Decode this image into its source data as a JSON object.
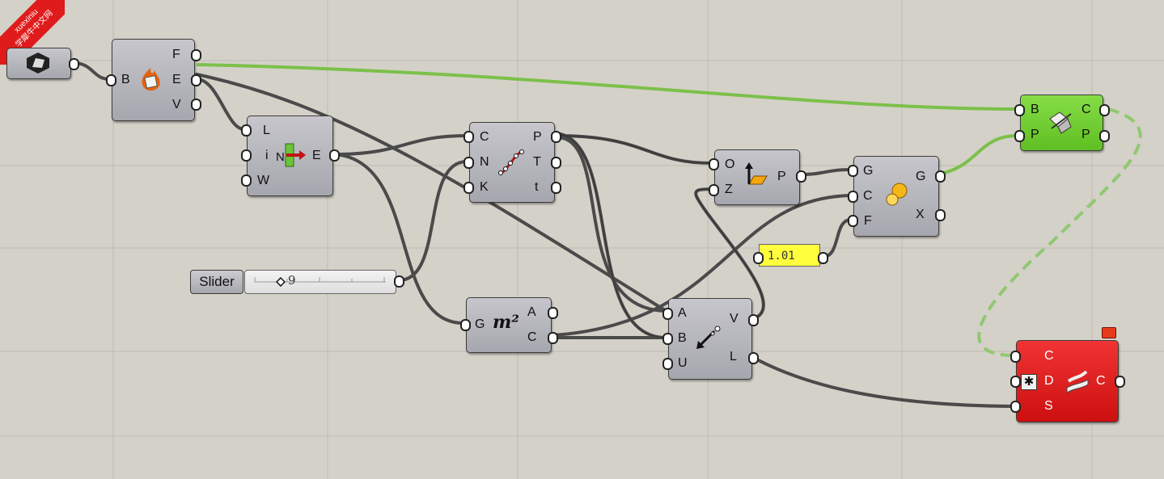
{
  "watermark": {
    "line1": "xuexiniu",
    "line2": "学犀牛中文网"
  },
  "components": {
    "geometry_param": {
      "icon": "brep-param-icon"
    },
    "deconstruct_brep": {
      "inputs": [
        "B"
      ],
      "outputs": [
        "F",
        "E",
        "V"
      ],
      "icon": "explode-brep-icon"
    },
    "list_item": {
      "inputs": [
        "L",
        "i",
        "W"
      ],
      "outputs": [
        "E"
      ],
      "icon": "list-item-icon"
    },
    "divide_curve": {
      "inputs": [
        "C",
        "N",
        "K"
      ],
      "outputs": [
        "P",
        "T",
        "t"
      ],
      "icon": "divide-curve-icon"
    },
    "xy_plane": {
      "inputs": [
        "O",
        "Z"
      ],
      "outputs": [
        "P"
      ],
      "icon": "plane-icon"
    },
    "scale": {
      "inputs": [
        "G",
        "C",
        "F"
      ],
      "outputs": [
        "G",
        "X"
      ],
      "icon": "scale-icon"
    },
    "split_brep": {
      "inputs": [
        "B",
        "P"
      ],
      "outputs": [
        "C",
        "P"
      ],
      "icon": "split-brep-icon"
    },
    "area": {
      "inputs": [
        "G"
      ],
      "outputs": [
        "A",
        "C"
      ],
      "icon_text": "m²"
    },
    "vector_2pt": {
      "inputs": [
        "A",
        "B",
        "U"
      ],
      "outputs": [
        "V",
        "L"
      ],
      "icon": "vector-icon"
    },
    "sweep": {
      "inputs": [
        "C",
        "D",
        "S"
      ],
      "outputs": [
        "C"
      ],
      "icon": "sweep-icon"
    }
  },
  "slider": {
    "label": "Slider",
    "value": "9"
  },
  "panel": {
    "value": "1.01"
  },
  "colors": {
    "canvas": "#d4d1c9",
    "component": "#b4b4ba",
    "green_component": "#6ccc2c",
    "red_component": "#e02020",
    "wire": "#4a4a4a",
    "selected_wire": "#7cc04a",
    "panel": "#ffff3d"
  }
}
